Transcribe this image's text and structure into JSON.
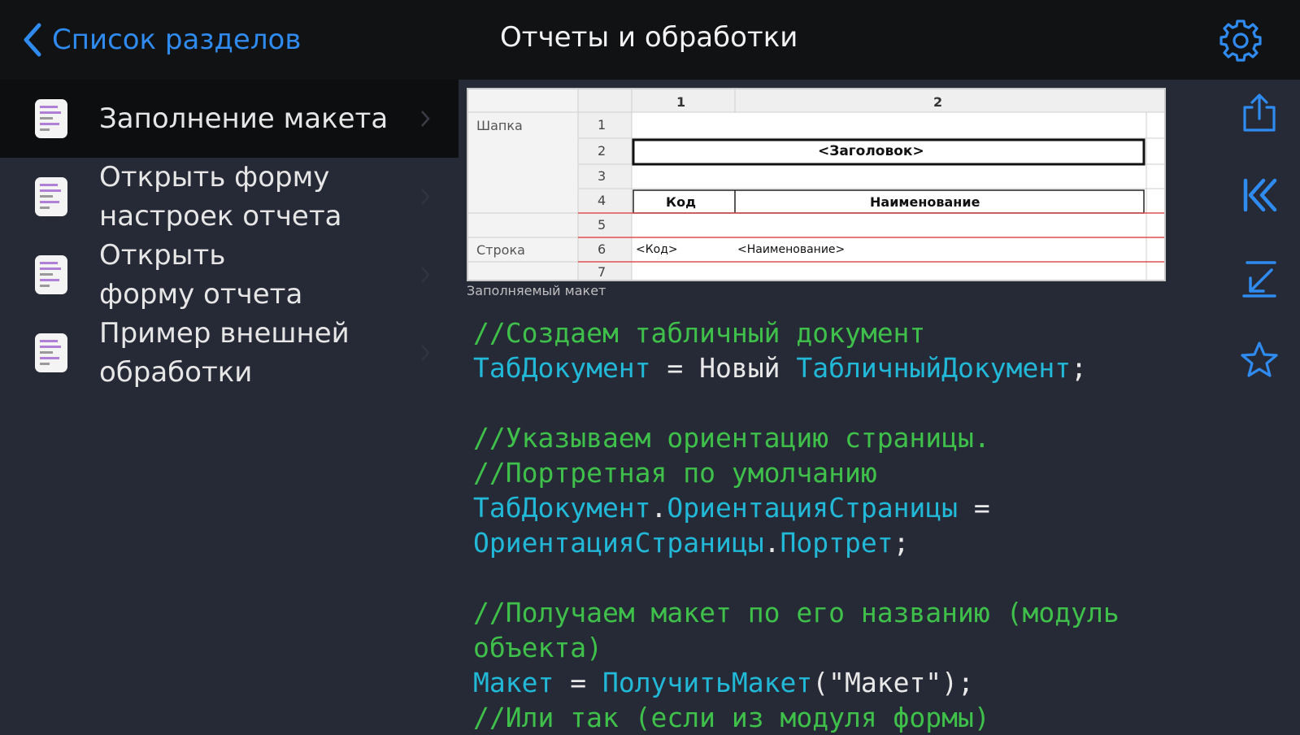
{
  "nav": {
    "back_label": "Список разделов",
    "title": "Отчеты и обработки"
  },
  "colors": {
    "accent": "#2f8bf0",
    "comment": "#3fc04a",
    "identifier": "#22b8d8"
  },
  "icons": {
    "settings": "gear-icon",
    "share": "share-icon",
    "first": "first-page-icon",
    "download": "download-icon",
    "favorite": "star-icon"
  },
  "sidebar": {
    "items": [
      {
        "label": "Заполнение макета",
        "selected": true
      },
      {
        "label": "Открыть форму\nнастроек отчета",
        "selected": false
      },
      {
        "label": "Открыть\nформу отчета",
        "selected": false
      },
      {
        "label": "Пример внешней\nобработки",
        "selected": false
      }
    ]
  },
  "sheet": {
    "col_headers": [
      "1",
      "2"
    ],
    "row_numbers": [
      "1",
      "2",
      "3",
      "4",
      "5",
      "6",
      "7"
    ],
    "area_header": "Шапка",
    "area_row": "Строка",
    "title_param": "<Заголовок>",
    "col_code": "Код",
    "col_name": "Наименование",
    "param_code": "<Код>",
    "param_name": "<Наименование>",
    "caption": "Заполняемый макет"
  },
  "code": {
    "l1": "//Создаем табличный документ",
    "l2a": "ТабДокумент",
    "l2b": " = Новый ",
    "l2c": "ТабличныйДокумент",
    "l2d": ";",
    "l3": "//Указываем ориентацию страницы.",
    "l4": "//Портретная по умолчанию",
    "l5a": "ТабДокумент",
    "l5b": ".",
    "l5c": "ОриентацияСтраницы",
    "l5d": " =",
    "l6a": "ОриентацияСтраницы",
    "l6b": ".",
    "l6c": "Портрет",
    "l6d": ";",
    "l7": "//Получаем макет по его названию (модуль",
    "l8": "объекта)",
    "l9a": "Макет",
    "l9b": " = ",
    "l9c": "ПолучитьМакет",
    "l9d": "(\"Макет\");",
    "l10": "//Или так (если из модуля формы)"
  }
}
